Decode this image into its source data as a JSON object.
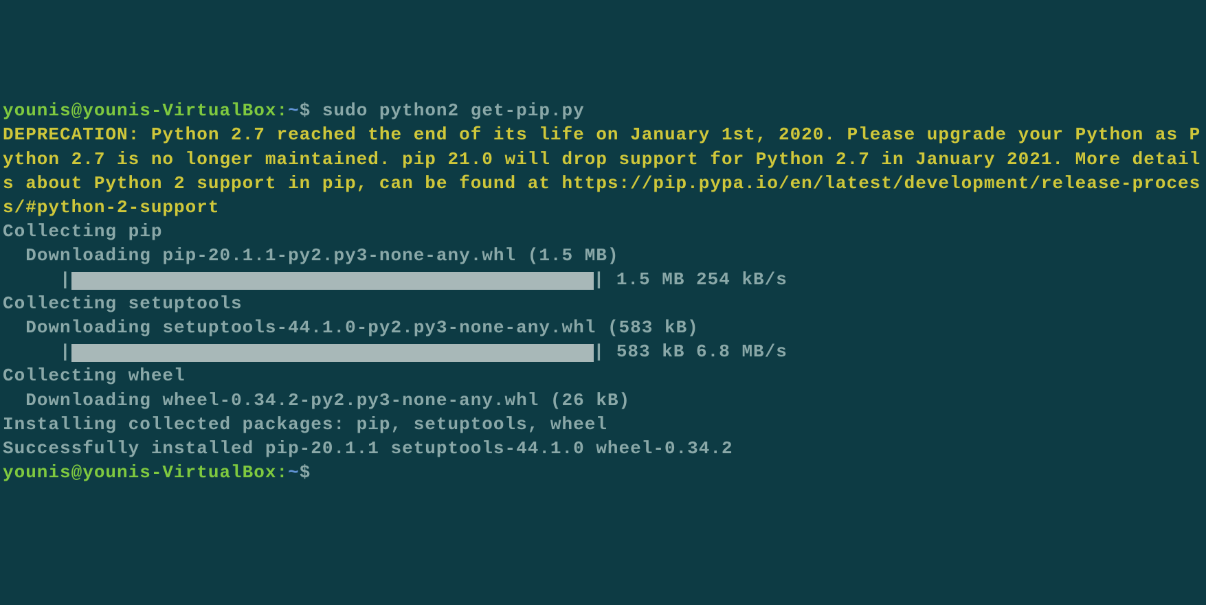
{
  "prompt1": {
    "user_host": "younis@younis-VirtualBox",
    "colon": ":",
    "path": "~",
    "dollar": "$ ",
    "command": "sudo python2 get-pip.py"
  },
  "deprecation": "DEPRECATION: Python 2.7 reached the end of its life on January 1st, 2020. Please upgrade your Python as Python 2.7 is no longer maintained. pip 21.0 will drop support for Python 2.7 in January 2021. More details about Python 2 support in pip, can be found at https://pip.pypa.io/en/latest/development/release-process/#python-2-support",
  "collecting_pip": "Collecting pip",
  "downloading_pip": "  Downloading pip-20.1.1-py2.py3-none-any.whl (1.5 MB)",
  "progress_pip_prefix": "     |",
  "progress_pip_suffix": "| 1.5 MB 254 kB/s",
  "collecting_setuptools": "Collecting setuptools",
  "downloading_setuptools": "  Downloading setuptools-44.1.0-py2.py3-none-any.whl (583 kB)",
  "progress_setuptools_prefix": "     |",
  "progress_setuptools_suffix": "| 583 kB 6.8 MB/s",
  "collecting_wheel": "Collecting wheel",
  "downloading_wheel": "  Downloading wheel-0.34.2-py2.py3-none-any.whl (26 kB)",
  "installing": "Installing collected packages: pip, setuptools, wheel",
  "success": "Successfully installed pip-20.1.1 setuptools-44.1.0 wheel-0.34.2",
  "prompt2": {
    "user_host": "younis@younis-VirtualBox",
    "colon": ":",
    "path": "~",
    "dollar": "$"
  }
}
